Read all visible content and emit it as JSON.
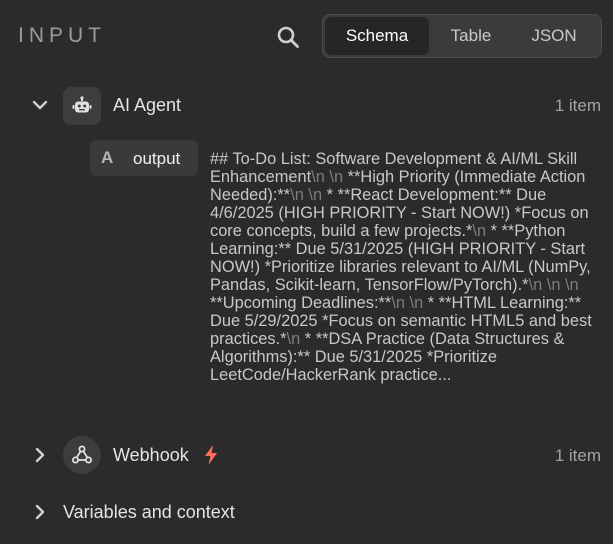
{
  "header": {
    "title": "INPUT",
    "tabs": [
      {
        "label": "Schema",
        "active": true
      },
      {
        "label": "Table",
        "active": false
      },
      {
        "label": "JSON",
        "active": false
      }
    ]
  },
  "nodes": [
    {
      "name": "AI Agent",
      "count": "1 item",
      "expanded": true,
      "icon": "robot-icon",
      "fields": [
        {
          "type_glyph": "A",
          "name": "output",
          "value_segments": [
            "## To-Do List: Software Development & AI/ML Skill Enhancement",
            "\\n",
            " ",
            "\\n",
            " **High Priority (Immediate Action Needed):**",
            "\\n",
            " ",
            "\\n",
            " * **React Development:** Due 4/6/2025 (HIGH PRIORITY - Start NOW!) *Focus on core concepts, build a few projects.*",
            "\\n",
            " * **Python Learning:** Due 5/31/2025 (HIGH PRIORITY - Start NOW!) *Prioritize libraries relevant to AI/ML (NumPy, Pandas, Scikit-learn, TensorFlow/PyTorch).*",
            "\\n",
            " ",
            "\\n",
            " ",
            "\\n",
            " **Upcoming Deadlines:**",
            "\\n",
            " ",
            "\\n",
            " * **HTML Learning:** Due 5/29/2025 *Focus on semantic HTML5 and best practices.*",
            "\\n",
            " * **DSA Practice (Data Structures & Algorithms):** Due 5/31/2025 *Prioritize LeetCode/HackerRank practice..."
          ]
        }
      ]
    },
    {
      "name": "Webhook",
      "count": "1 item",
      "expanded": false,
      "icon": "webhook-icon",
      "trigger_icon": "bolt-icon"
    }
  ],
  "variables": {
    "label": "Variables and context"
  },
  "colors": {
    "background": "#2b2b2b",
    "text": "#d6d6d6",
    "muted": "#a3a3a3",
    "newline_marker": "#7d7d7d",
    "trigger_accent": "#ff6d5a"
  }
}
